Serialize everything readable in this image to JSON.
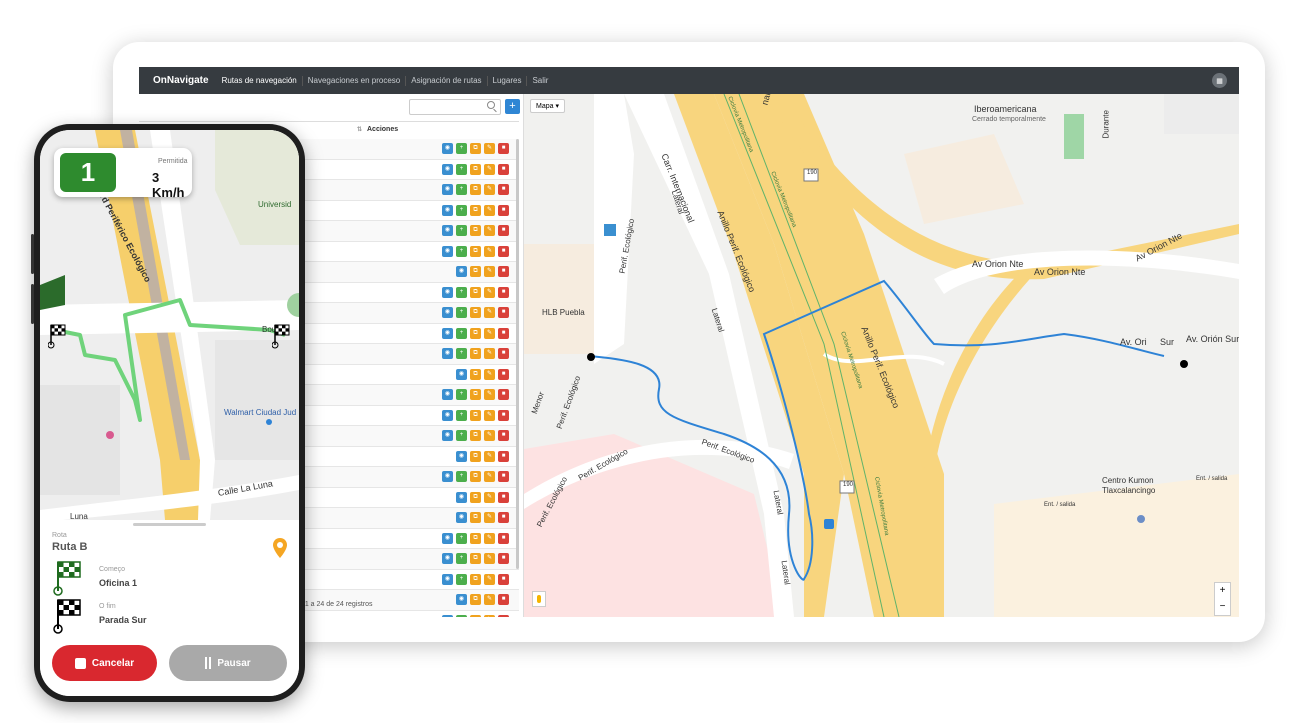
{
  "app": {
    "brand": "OnNavigate",
    "nav": [
      {
        "label": "Rutas de navegación",
        "active": true
      },
      {
        "label": "Navegaciones en proceso",
        "active": false
      },
      {
        "label": "Asignación de rutas",
        "active": false
      },
      {
        "label": "Lugares",
        "active": false
      },
      {
        "label": "Salir",
        "active": false
      }
    ],
    "user_icon": "menu-icon"
  },
  "list": {
    "add_label": "+",
    "column_acciones": "Acciones",
    "rows": [
      {
        "add": true
      },
      {
        "add": true
      },
      {
        "add": true
      },
      {
        "add": true
      },
      {
        "add": true
      },
      {
        "add": true
      },
      {
        "add": false
      },
      {
        "add": true
      },
      {
        "add": true
      },
      {
        "add": true
      },
      {
        "add": true
      },
      {
        "add": false
      },
      {
        "add": true
      },
      {
        "add": true
      },
      {
        "add": true
      },
      {
        "add": false
      },
      {
        "add": true
      },
      {
        "add": false
      },
      {
        "add": false
      },
      {
        "add": true
      },
      {
        "add": true
      },
      {
        "add": true
      },
      {
        "add": false
      },
      {
        "add": true
      }
    ],
    "footer": "o 1 a 24 de 24 registros"
  },
  "map": {
    "type_label": "Mapa",
    "labels": {
      "carr_internacional": "Carr. Internacional",
      "anillo1": "Anillo Perif. Ecológico",
      "anillo2": "Anillo Perif. Ecológico",
      "lateral1": "Lateral",
      "lateral2": "Lateral",
      "lateral3": "Lateral",
      "lateral4": "Lateral",
      "perif1": "Perif. Ecológico",
      "perif2": "Perif. Ecológico",
      "perif3": "Perif. Ecológico",
      "perif4": "Perif. Ecológico",
      "perif5": "Perif. Ecológico",
      "av_orion_nte1": "Av Orion Nte",
      "av_orion_nte2": "Av Orion Nte",
      "av_orion_nte3": "Av Orion Nte",
      "av_orion_sur1": "Av. Ori",
      "av_orion_sur2": "Sur",
      "av_orion_sur3": "Av. Orión Sur",
      "iberoamericana": "Iberoamericana",
      "cerrado": "Cerrado temporalmente",
      "hlb": "HLB Puebla",
      "kumon1": "Centro Kumon",
      "kumon2": "Tlaxcalancingo",
      "ent_salida1": "Ent. / salida",
      "ent_salida2": "Ent. / salida",
      "durante": "Durante",
      "menor": "Menor",
      "ciclovia1": "Ciclovía Metropolitana",
      "ciclovia2": "Ciclovía Metropolitana",
      "ciclovia3": "Ciclovía Metropolitana",
      "ciclovia4": "Ciclovía Metropolitana",
      "ciclovia5": "Ciclovía Metropolitana",
      "ciclovia6": "Ciclovía Metropolitana",
      "ciclovia7": "Ciclovía Metropolitana",
      "shield1": "190",
      "shield2": "190",
      "nal": "nal",
      "zoom_in": "+",
      "zoom_out": "−"
    }
  },
  "phone": {
    "speed_number": "1",
    "speed_label": "Permitida",
    "speed_value": "3 Km/h",
    "map_labels": {
      "periferico": "ard Periférico Ecológico",
      "universidad": "Universid",
      "walmart": "Walmart Ciudad Jud",
      "calle_luna": "Calle La Luna",
      "luna": "Luna",
      "bou": "Bou"
    },
    "route_label": "Rota",
    "route_name": "Ruta B",
    "start_label": "Começo",
    "start_value": "Oficina 1",
    "end_label": "O fim",
    "end_value": "Parada Sur",
    "cancel_label": "Cancelar",
    "pause_label": "Pausar",
    "colors": {
      "green": "#2e8b2e",
      "red": "#d9282f",
      "gray": "#a9a9a9",
      "route": "#2e83d6"
    }
  }
}
